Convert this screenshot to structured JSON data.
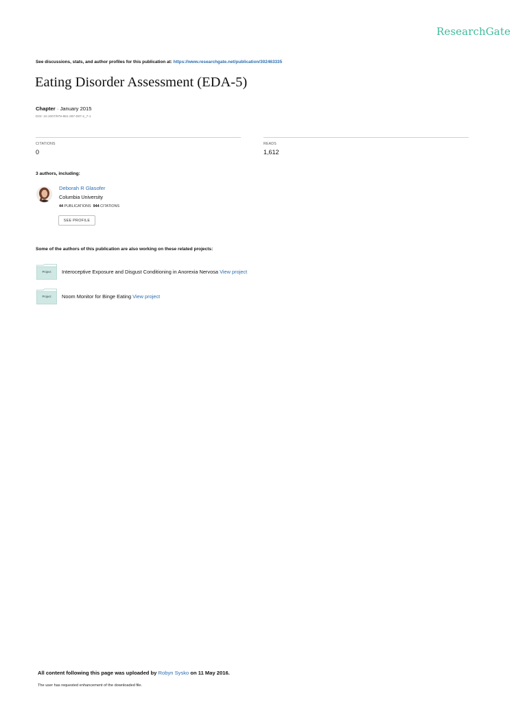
{
  "brand": {
    "name": "ResearchGate",
    "color": "#40ba9b"
  },
  "link_color": "#2a6db1",
  "header": {
    "discussions_text": "See discussions, stats, and author profiles for this publication at: ",
    "publication_url": "https://www.researchgate.net/publication/302463335"
  },
  "publication": {
    "title": "Eating Disorder Assessment (EDA-5)",
    "type": "Chapter",
    "separator": " · ",
    "date": "January 2015",
    "doi": "DOI: 10.1007/978-981-287-087-2_7-1"
  },
  "stats": {
    "citations_label": "CITATIONS",
    "citations_value": "0",
    "reads_label": "READS",
    "reads_value": "1,612"
  },
  "authors": {
    "heading": "3 authors, including:",
    "list": [
      {
        "name": "Deborah R Glasofer",
        "affiliation": "Columbia University",
        "publications_count": "44",
        "publications_label": " PUBLICATIONS",
        "citations_count": "944",
        "citations_label": " CITATIONS",
        "button_label": "SEE PROFILE"
      }
    ]
  },
  "related": {
    "heading": "Some of the authors of this publication are also working on these related projects:",
    "folder_label": "Project",
    "view_label": "View project",
    "projects": [
      {
        "title": "Interoceptive Exposure and Disgust Conditioning in Anorexia Nervosa "
      },
      {
        "title": "Noom Monitor for Binge Eating "
      }
    ]
  },
  "footer": {
    "uploaded_prefix": "All content following this page was uploaded by ",
    "uploader": "Robyn Sysko",
    "uploaded_suffix": " on 11 May 2016.",
    "note": "The user has requested enhancement of the downloaded file."
  }
}
